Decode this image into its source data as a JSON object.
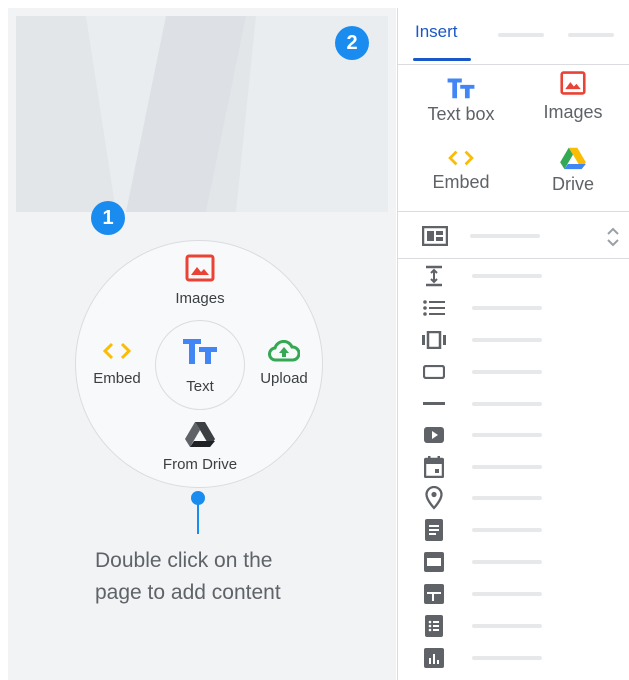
{
  "badges": {
    "one": "1",
    "two": "2"
  },
  "wheel": {
    "images": "Images",
    "embed": "Embed",
    "text": "Text",
    "upload": "Upload",
    "from_drive": "From Drive"
  },
  "hint": {
    "line1": "Double click on the",
    "line2": "page to add content"
  },
  "panel": {
    "tab_insert": "Insert",
    "grid": {
      "text_box": "Text box",
      "images": "Images",
      "embed": "Embed",
      "drive": "Drive"
    }
  },
  "colors": {
    "accent": "#1a57c8",
    "badge": "#1a8cf0",
    "images_red": "#ea4335",
    "embed_yellow": "#fbbc04",
    "upload_green": "#34a853",
    "text_blue": "#4285f4"
  },
  "list_icons": [
    "divider-spacing-icon",
    "bulleted-list-icon",
    "carousel-icon",
    "button-icon",
    "line-icon",
    "youtube-icon",
    "calendar-icon",
    "map-pin-icon",
    "document-icon",
    "slides-icon",
    "sheets-icon",
    "forms-icon",
    "charts-icon"
  ]
}
